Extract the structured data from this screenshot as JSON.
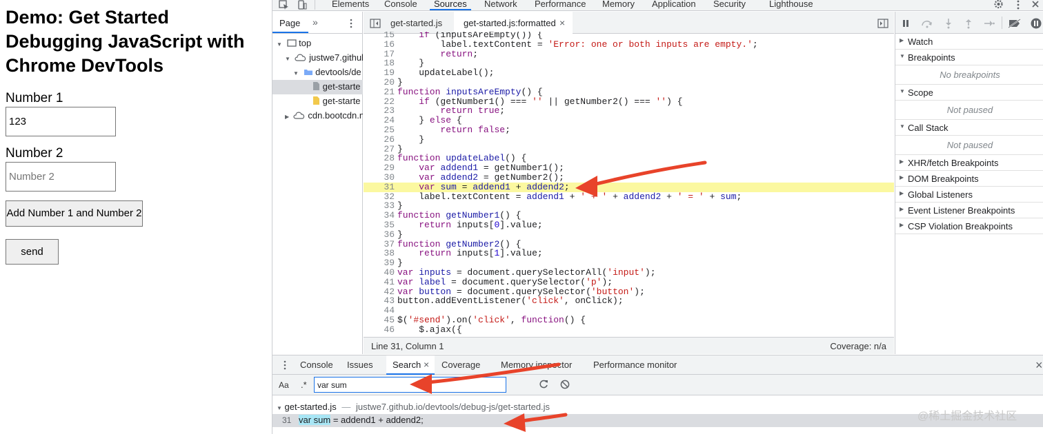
{
  "demo": {
    "heading": "Demo: Get Started Debugging JavaScript with Chrome DevTools",
    "number1_label": "Number 1",
    "number1_value": "123",
    "number2_label": "Number 2",
    "number2_placeholder": "Number 2",
    "add_button": "Add Number 1 and Number 2",
    "send_button": "send"
  },
  "devtools": {
    "main_tabs": [
      "Elements",
      "Console",
      "Sources",
      "Network",
      "Performance",
      "Memory",
      "Application",
      "Security",
      "Lighthouse"
    ],
    "active_tab": "Sources",
    "navigator": {
      "page_tab": "Page",
      "more": "»",
      "tree": [
        "top",
        "justwe7.github",
        "devtools/de",
        "get-starte",
        "get-starte",
        "cdn.bootcdn.n"
      ]
    },
    "editor": {
      "tabs": [
        "get-started.js",
        "get-started.js:formatted"
      ],
      "close_glyph": "×",
      "highlight_line": 31,
      "status_position": "Line 31, Column 1",
      "status_coverage": "Coverage: n/a"
    },
    "code_lines": [
      {
        "n": "15",
        "html": "    <span class=\"kw\">if</span> (inputsAreEmpty()) {"
      },
      {
        "n": "16",
        "html": "        label.textContent = <span class=\"st\">'Error: one or both inputs are empty.'</span>;"
      },
      {
        "n": "17",
        "html": "        <span class=\"kw\">return</span>;"
      },
      {
        "n": "18",
        "html": "    }"
      },
      {
        "n": "19",
        "html": "    updateLabel();"
      },
      {
        "n": "20",
        "html": "}"
      },
      {
        "n": "21",
        "html": "<span class=\"kw\">function</span> <span class=\"fn\">inputsAreEmpty</span>() {"
      },
      {
        "n": "22",
        "html": "    <span class=\"kw\">if</span> (getNumber1() === <span class=\"st\">''</span> || getNumber2() === <span class=\"st\">''</span>) {"
      },
      {
        "n": "23",
        "html": "        <span class=\"kw\">return</span> <span class=\"kw\">true</span>;"
      },
      {
        "n": "24",
        "html": "    } <span class=\"kw\">else</span> {"
      },
      {
        "n": "25",
        "html": "        <span class=\"kw\">return</span> <span class=\"kw\">false</span>;"
      },
      {
        "n": "26",
        "html": "    }"
      },
      {
        "n": "27",
        "html": "}"
      },
      {
        "n": "28",
        "html": "<span class=\"kw\">function</span> <span class=\"fn\">updateLabel</span>() {"
      },
      {
        "n": "29",
        "html": "    <span class=\"kw\">var</span> <span class=\"fn\">addend1</span> = getNumber1();"
      },
      {
        "n": "30",
        "html": "    <span class=\"kw\">var</span> <span class=\"fn\">addend2</span> = getNumber2();"
      },
      {
        "n": "31",
        "html": "    <span class=\"kw\">var</span> <span class=\"fn\">sum</span> = <span class=\"fn\">addend1</span> + <span class=\"fn\">addend2</span>;"
      },
      {
        "n": "32",
        "html": "    label.textContent = <span class=\"fn\">addend1</span> + <span class=\"st\">' + '</span> + <span class=\"fn\">addend2</span> + <span class=\"st\">' = '</span> + <span class=\"fn\">sum</span>;"
      },
      {
        "n": "33",
        "html": "}"
      },
      {
        "n": "34",
        "html": "<span class=\"kw\">function</span> <span class=\"fn\">getNumber1</span>() {"
      },
      {
        "n": "35",
        "html": "    <span class=\"kw\">return</span> inputs[<span class=\"nm\">0</span>].value;"
      },
      {
        "n": "36",
        "html": "}"
      },
      {
        "n": "37",
        "html": "<span class=\"kw\">function</span> <span class=\"fn\">getNumber2</span>() {"
      },
      {
        "n": "38",
        "html": "    <span class=\"kw\">return</span> inputs[<span class=\"nm\">1</span>].value;"
      },
      {
        "n": "39",
        "html": "}"
      },
      {
        "n": "40",
        "html": "<span class=\"kw\">var</span> <span class=\"fn\">inputs</span> = document.querySelectorAll(<span class=\"st\">'input'</span>);"
      },
      {
        "n": "41",
        "html": "<span class=\"kw\">var</span> <span class=\"fn\">label</span> = document.querySelector(<span class=\"st\">'p'</span>);"
      },
      {
        "n": "42",
        "html": "<span class=\"kw\">var</span> <span class=\"fn\">button</span> = document.querySelector(<span class=\"st\">'button'</span>);"
      },
      {
        "n": "43",
        "html": "button.addEventListener(<span class=\"st\">'click'</span>, onClick);"
      },
      {
        "n": "44",
        "html": ""
      },
      {
        "n": "45",
        "html": "$(<span class=\"st\">'#send'</span>).on(<span class=\"st\">'click'</span>, <span class=\"kw\">function</span>() {"
      },
      {
        "n": "46",
        "html": "    $.ajax({"
      }
    ],
    "right_pane": {
      "sections": [
        "Watch",
        "Breakpoints",
        "Scope",
        "Call Stack",
        "XHR/fetch Breakpoints",
        "DOM Breakpoints",
        "Global Listeners",
        "Event Listener Breakpoints",
        "CSP Violation Breakpoints"
      ],
      "no_breakpoints": "No breakpoints",
      "scope_note": "Not paused",
      "callstack_note": "Not paused"
    },
    "drawer": {
      "tabs": [
        "Console",
        "Issues",
        "Search",
        "Coverage",
        "Memory inspector",
        "Performance monitor"
      ],
      "close_glyph": "×",
      "case_toggle": "Aa",
      "regex_toggle": ".*",
      "search_value": "var sum",
      "result_file": "get-started.js",
      "result_sep": "—",
      "result_path": "justwe7.github.io/devtools/debug-js/get-started.js",
      "result_line": "31",
      "result_match": "var sum",
      "result_rest": " = addend1 + addend2;"
    },
    "watermark": "@稀土掘金技术社区",
    "annotation_color": "#e8432a"
  }
}
